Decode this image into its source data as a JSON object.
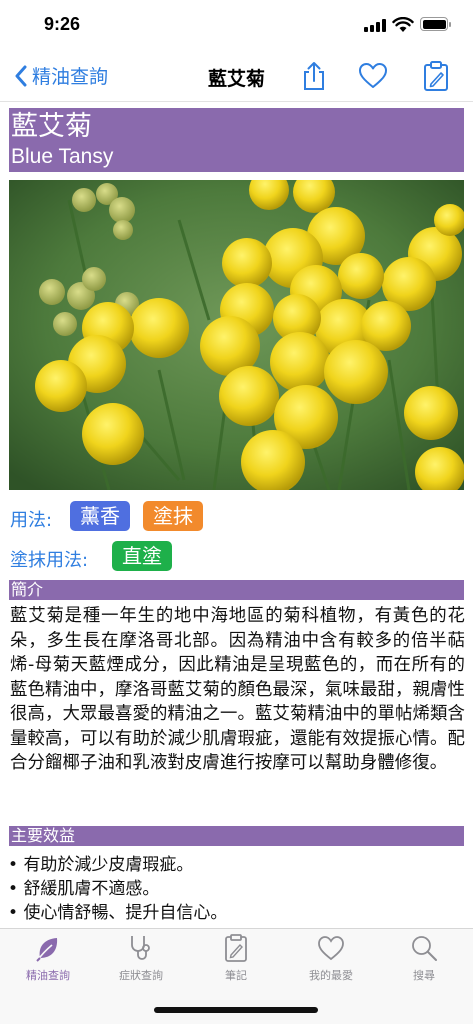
{
  "status": {
    "time": "9:26"
  },
  "nav": {
    "back_label": "精油查詢",
    "title": "藍艾菊"
  },
  "oil": {
    "name_zh": "藍艾菊",
    "name_en": "Blue Tansy"
  },
  "usage": {
    "label": "用法:",
    "tags": [
      {
        "text": "薰香",
        "color": "#4f6fe0"
      },
      {
        "text": "塗抹",
        "color": "#f28a2c"
      }
    ],
    "topical_label": "塗抹用法:",
    "topical_tags": [
      {
        "text": "直塗",
        "color": "#1eb04a"
      }
    ]
  },
  "intro": {
    "heading": "簡介",
    "text": "藍艾菊是種一年生的地中海地區的菊科植物，有黃色的花朵，多生長在摩洛哥北部。因為精油中含有較多的倍半萜烯-母菊天藍煙成分，因此精油是呈現藍色的，而在所有的藍色精油中，摩洛哥藍艾菊的顏色最深，氣味最甜，親膚性很高，大眾最喜愛的精油之一。藍艾菊精油中的單帖烯類含量較高，可以有助於減少肌膚瑕疵，還能有效提振心情。配合分餾椰子油和乳液對皮膚進行按摩可以幫助身體修復。"
  },
  "benefits": {
    "heading": "主要效益",
    "items": [
      "有助於減少皮膚瑕疵。",
      "舒緩肌膚不適感。",
      "使心情舒暢、提升自信心。"
    ]
  },
  "tabs": [
    {
      "label": "精油查詢",
      "icon": "leaf-icon",
      "active": true
    },
    {
      "label": "症狀查詢",
      "icon": "stethoscope-icon",
      "active": false
    },
    {
      "label": "筆記",
      "icon": "clipboard-icon",
      "active": false
    },
    {
      "label": "我的最愛",
      "icon": "heart-icon",
      "active": false
    },
    {
      "label": "搜尋",
      "icon": "search-icon",
      "active": false
    }
  ],
  "colors": {
    "accent": "#2f7ee0",
    "brand": "#8a6aad",
    "tab_inactive": "#8e8e93"
  }
}
